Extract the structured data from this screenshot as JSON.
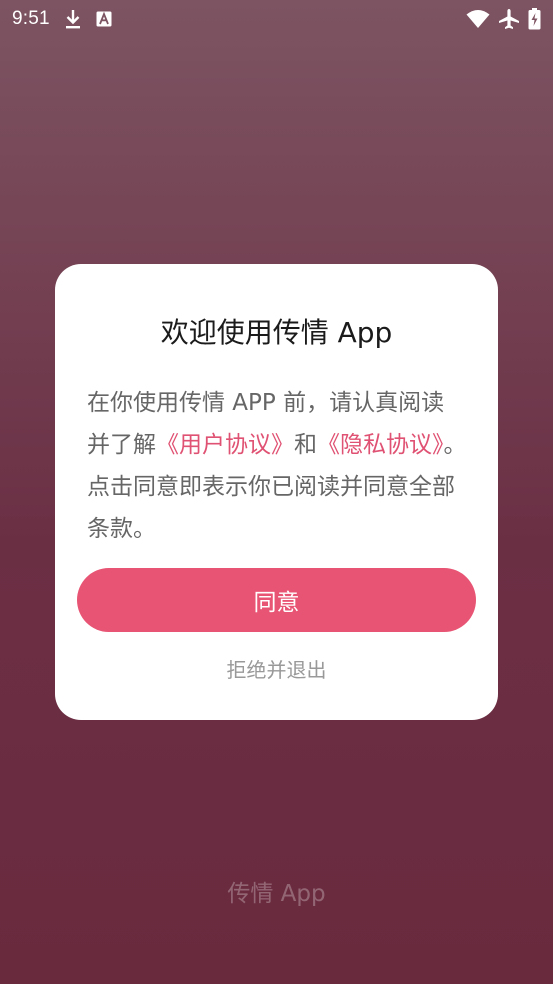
{
  "status_bar": {
    "time": "9:51",
    "notification_icons": [
      "download-icon",
      "a-letter-icon"
    ],
    "system_icons": [
      "wifi-icon",
      "airplane-icon",
      "battery-charging-icon"
    ]
  },
  "dialog": {
    "title": "欢迎使用传情 App",
    "body": {
      "part1": "在你使用传情 APP 前，请认真阅读并了解",
      "user_agreement_link": "《用户协议》",
      "and": "和",
      "privacy_link": "《隐私协议》",
      "part2": "。点击同意即表示你已阅读并同意全部条款。"
    },
    "agree_label": "同意",
    "decline_label": "拒绝并退出"
  },
  "footer": {
    "brand": "传情 App"
  },
  "colors": {
    "accent": "#e85473",
    "link": "#e05273",
    "background_top": "#7d5462",
    "background_bottom": "#6a2a3e"
  }
}
